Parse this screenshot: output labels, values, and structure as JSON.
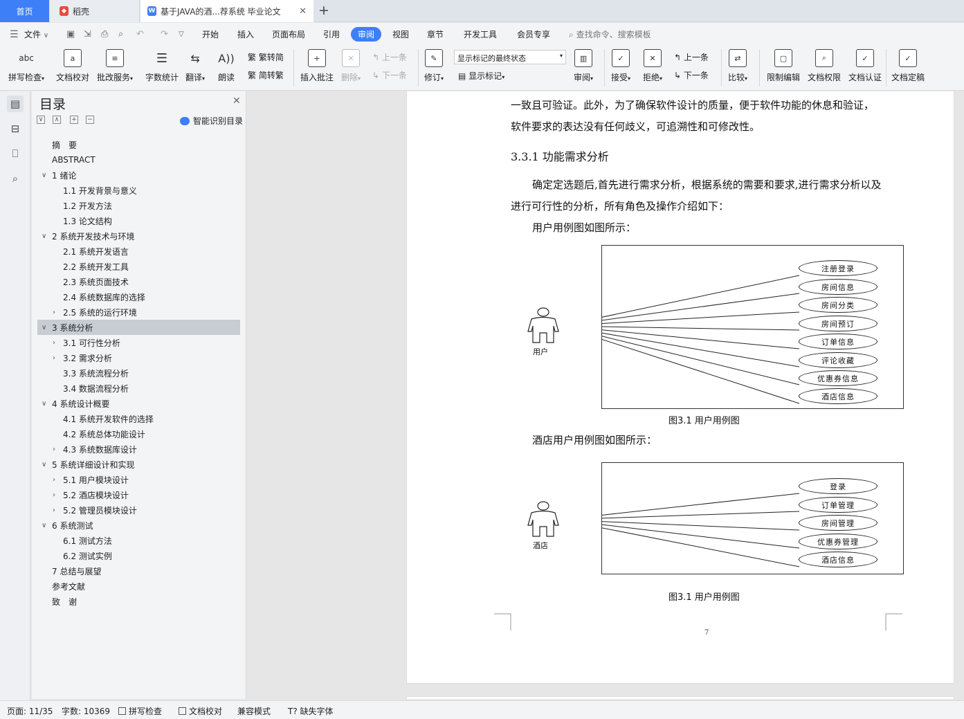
{
  "tabs": {
    "home": "首页",
    "daoke": "稻壳",
    "doc": "基于JAVA的酒...荐系统 毕业论文",
    "doc_logo": "W"
  },
  "menubar": {
    "file": "文件",
    "items": [
      "开始",
      "插入",
      "页面布局",
      "引用",
      "审阅",
      "视图",
      "章节",
      "开发工具",
      "会员专享"
    ],
    "search_placeholder": "查找命令、搜索模板"
  },
  "ribbon": {
    "spellcheck": "拼写检查",
    "spellcheck_icon_text": "abc",
    "doc_check": "文档校对",
    "batch_service": "批改服务",
    "word_count": "字数统计",
    "translate": "翻译",
    "read_aloud": "朗读",
    "to_traditional": "繁转简",
    "to_simplified": "简转繁",
    "insert_comment": "插入批注",
    "delete": "删除",
    "prev_comment": "上一条",
    "next_comment": "下一条",
    "revise": "修订",
    "markup_state": "显示标记的最终状态",
    "show_markup": "显示标记",
    "review": "审阅",
    "accept": "接受",
    "reject": "拒绝",
    "prev_change": "上一条",
    "next_change": "下一条",
    "compare": "比较",
    "restrict_edit": "限制编辑",
    "doc_permission": "文档权限",
    "doc_certify": "文档认证",
    "doc_finalize": "文档定稿"
  },
  "toc": {
    "title": "目录",
    "smart_label": "智能识别目录",
    "items": [
      {
        "label": "摘　要",
        "level": 1,
        "chevron": ""
      },
      {
        "label": "ABSTRACT",
        "level": 1,
        "chevron": ""
      },
      {
        "label": "1 绪论",
        "level": 1,
        "chevron": "down"
      },
      {
        "label": "1.1 开发背景与意义",
        "level": 2,
        "chevron": ""
      },
      {
        "label": "1.2 开发方法",
        "level": 2,
        "chevron": ""
      },
      {
        "label": "1.3 论文结构",
        "level": 2,
        "chevron": ""
      },
      {
        "label": "2 系统开发技术与环境",
        "level": 1,
        "chevron": "down"
      },
      {
        "label": "2.1  系统开发语言",
        "level": 2,
        "chevron": ""
      },
      {
        "label": "2.2  系统开发工具",
        "level": 2,
        "chevron": ""
      },
      {
        "label": "2.3  系统页面技术",
        "level": 2,
        "chevron": ""
      },
      {
        "label": "2.4  系统数据库的选择",
        "level": 2,
        "chevron": ""
      },
      {
        "label": "2.5  系统的运行环境",
        "level": 2,
        "chevron": "right"
      },
      {
        "label": "3  系统分析",
        "level": 1,
        "chevron": "down",
        "selected": true
      },
      {
        "label": "3.1 可行性分析",
        "level": 2,
        "chevron": "right"
      },
      {
        "label": "3.2 需求分析",
        "level": 2,
        "chevron": "right"
      },
      {
        "label": "3.3 系统流程分析",
        "level": 2,
        "chevron": ""
      },
      {
        "label": "3.4 数据流程分析",
        "level": 2,
        "chevron": ""
      },
      {
        "label": "4  系统设计概要",
        "level": 1,
        "chevron": "down"
      },
      {
        "label": "4.1  系统开发软件的选择",
        "level": 2,
        "chevron": ""
      },
      {
        "label": "4.2  系统总体功能设计",
        "level": 2,
        "chevron": ""
      },
      {
        "label": "4.3  系统数据库设计",
        "level": 2,
        "chevron": "right"
      },
      {
        "label": "5  系统详细设计和实现",
        "level": 1,
        "chevron": "down"
      },
      {
        "label": "5.1  用户模块设计",
        "level": 2,
        "chevron": "right"
      },
      {
        "label": "5.2  酒店模块设计",
        "level": 2,
        "chevron": "right"
      },
      {
        "label": "5.2  管理员模块设计",
        "level": 2,
        "chevron": "right"
      },
      {
        "label": "6  系统测试",
        "level": 1,
        "chevron": "down"
      },
      {
        "label": "6.1  测试方法",
        "level": 2,
        "chevron": ""
      },
      {
        "label": "6.2  测试实例",
        "level": 2,
        "chevron": ""
      },
      {
        "label": "7  总结与展望",
        "level": 1,
        "chevron": ""
      },
      {
        "label": "参考文献",
        "level": 1,
        "chevron": ""
      },
      {
        "label": "致　谢",
        "level": 1,
        "chevron": ""
      }
    ]
  },
  "document": {
    "para1_line1": "一致且可验证。此外，为了确保软件设计的质量，便于软件功能的休息和验证，",
    "para1_line2": "软件要求的表达没有任何歧义，可追溯性和可修改性。",
    "heading": "3.3.1  功能需求分析",
    "para2_line1": "确定定选题后,首先进行需求分析，根据系统的需要和要求,进行需求分析以及",
    "para2_line2": "进行可行性的分析，所有角色及操作介绍如下：",
    "para3": "用户用例图如图所示：",
    "figure1": {
      "actor": "用户",
      "use_cases": [
        "注册登录",
        "房间信息",
        "房间分类",
        "房间预订",
        "订单信息",
        "评论收藏",
        "优惠券信息",
        "酒店信息"
      ],
      "caption": "图3.1  用户用例图"
    },
    "para4": "酒店用户用例图如图所示：",
    "figure2": {
      "actor": "酒店",
      "use_cases": [
        "登录",
        "订单管理",
        "房间管理",
        "优惠券管理",
        "酒店信息"
      ],
      "caption": "图3.1  用户用例图"
    },
    "page_number": "7"
  },
  "status": {
    "page": "页面: 11/35",
    "words": "字数: 10369",
    "spellcheck": "拼写检查",
    "doc_check": "文档校对",
    "compat": "兼容模式",
    "missing_font": "缺失字体"
  }
}
